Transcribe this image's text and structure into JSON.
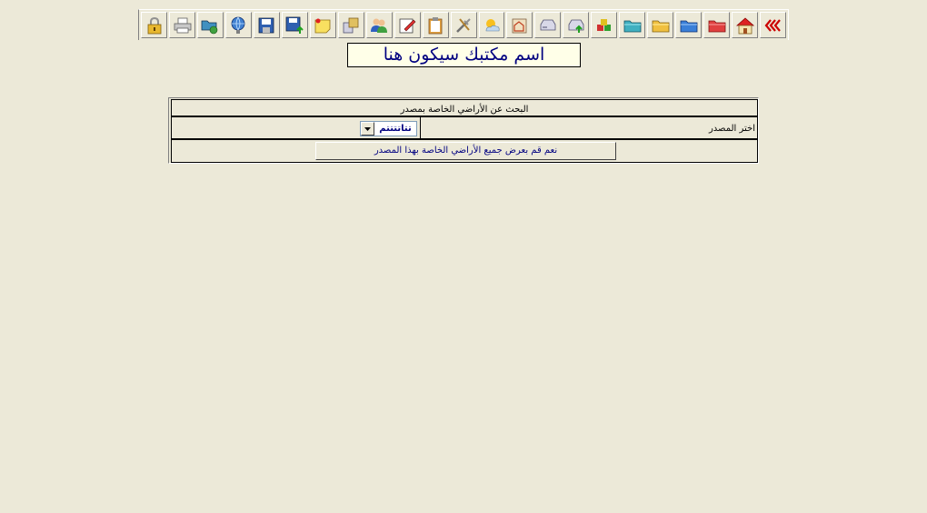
{
  "toolbar": {
    "buttons": [
      {
        "icon": "chevrons-icon"
      },
      {
        "icon": "home-icon"
      },
      {
        "icon": "red-folder-icon"
      },
      {
        "icon": "blue-folder-icon"
      },
      {
        "icon": "yellow-folder-icon"
      },
      {
        "icon": "teal-folder-icon"
      },
      {
        "icon": "cubes-icon"
      },
      {
        "icon": "drive-upload-icon"
      },
      {
        "icon": "drive-icon"
      },
      {
        "icon": "house-edit-icon"
      },
      {
        "icon": "weather-icon"
      },
      {
        "icon": "tools-icon"
      },
      {
        "icon": "clipboard-icon"
      },
      {
        "icon": "edit-icon"
      },
      {
        "icon": "users-icon"
      },
      {
        "icon": "transfer-icon"
      },
      {
        "icon": "sticky-note-icon"
      },
      {
        "icon": "save-as-icon"
      },
      {
        "icon": "save-icon"
      },
      {
        "icon": "network-icon"
      },
      {
        "icon": "folder-network-icon"
      },
      {
        "icon": "printer-icon"
      },
      {
        "icon": "lock-icon"
      }
    ]
  },
  "office_name": "اسم مكتبك سيكون هنا",
  "search": {
    "title": "البحث عن الأراضي الخاصة بمصدر",
    "source_label": "اختر المصدر",
    "source_value": "تتاتتتتم",
    "show_button": "نعم قم بعرض جميع الأراضي الخاصة بهذا المصدر"
  },
  "colors": {
    "background": "#ECE9D8",
    "office_text": "#000080",
    "office_bg": "#FFFFE8"
  }
}
